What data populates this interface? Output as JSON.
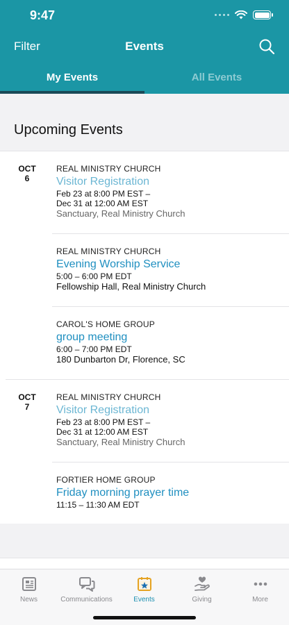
{
  "status": {
    "time": "9:47"
  },
  "nav": {
    "filter_label": "Filter",
    "title": "Events"
  },
  "tabs": {
    "my": "My Events",
    "all": "All Events"
  },
  "section": {
    "title": "Upcoming Events"
  },
  "days": [
    {
      "month": "OCT",
      "day": "6",
      "events": [
        {
          "org": "REAL MINISTRY CHURCH",
          "name": "Visitor Registration",
          "time_line1": "Feb 23 at 8:00 PM EST –",
          "time_line2": "Dec 31 at 12:00 AM EST",
          "location": "Sanctuary, Real Ministry Church"
        },
        {
          "org": "REAL MINISTRY CHURCH",
          "name": "Evening Worship Service",
          "time_line1": "5:00 – 6:00 PM EDT",
          "location": "Fellowship Hall, Real Ministry Church"
        },
        {
          "org": "CAROL'S HOME GROUP",
          "name": "group meeting",
          "time_line1": "6:00 – 7:00 PM EDT",
          "location": "180 Dunbarton Dr, Florence, SC"
        }
      ]
    },
    {
      "month": "OCT",
      "day": "7",
      "events": [
        {
          "org": "REAL MINISTRY CHURCH",
          "name": "Visitor Registration",
          "time_line1": "Feb 23 at 8:00 PM EST –",
          "time_line2": "Dec 31 at 12:00 AM EST",
          "location": "Sanctuary, Real Ministry Church"
        },
        {
          "org": "FORTIER HOME GROUP",
          "name": "Friday morning prayer time",
          "time_line1": "11:15 – 11:30 AM EDT"
        }
      ]
    }
  ],
  "tabbar": {
    "items": [
      {
        "label": "News",
        "icon": "news-icon"
      },
      {
        "label": "Communications",
        "icon": "chat-icon"
      },
      {
        "label": "Events",
        "icon": "calendar-star-icon",
        "active": true
      },
      {
        "label": "Giving",
        "icon": "giving-hand-icon"
      },
      {
        "label": "More",
        "icon": "more-dots-icon"
      }
    ]
  },
  "colors": {
    "header": "#1b96a5",
    "link": "#1f8fc0",
    "link_light": "#6bb6d3",
    "active_tab": "#1b8fb0"
  }
}
